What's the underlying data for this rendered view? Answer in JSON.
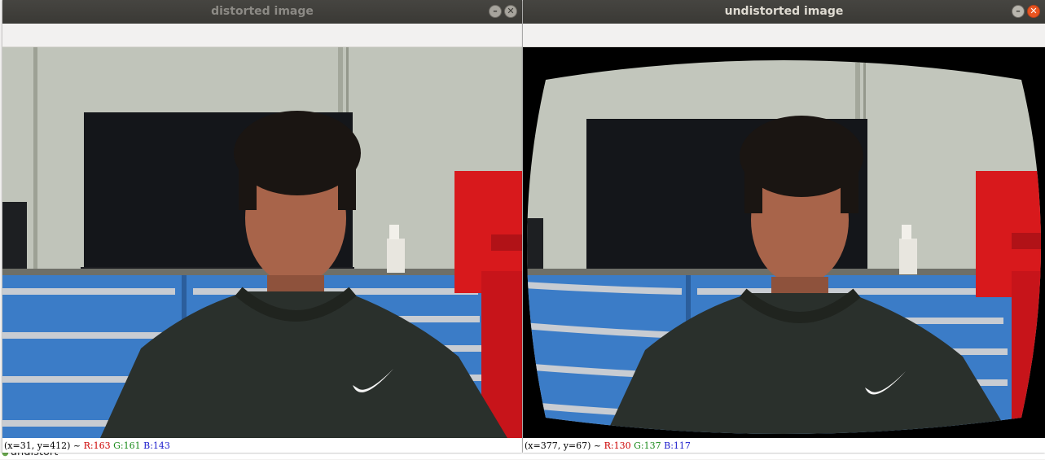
{
  "background": {
    "taskbar_label": "undistort"
  },
  "left_window": {
    "title": "distorted image",
    "status": {
      "coords": "(x=31, y=412) ~",
      "r": "R:163",
      "g": "G:161",
      "b": "B:143"
    }
  },
  "right_window": {
    "title": "undistorted image",
    "status": {
      "coords": "(x=377, y=67) ~",
      "r": "R:130",
      "g": "G:137",
      "b": "B:117"
    }
  },
  "colors": {
    "wall": "#b9bdb2",
    "monitor": "#14161a",
    "cabinet_blue": "#3b7cc7",
    "cabinet_red": "#d8191c",
    "hoodie": "#2a302c",
    "skin": "#a8644a",
    "close_accent": "#e95420"
  },
  "icons": {
    "minimize": "minimize-icon",
    "close": "close-icon"
  }
}
